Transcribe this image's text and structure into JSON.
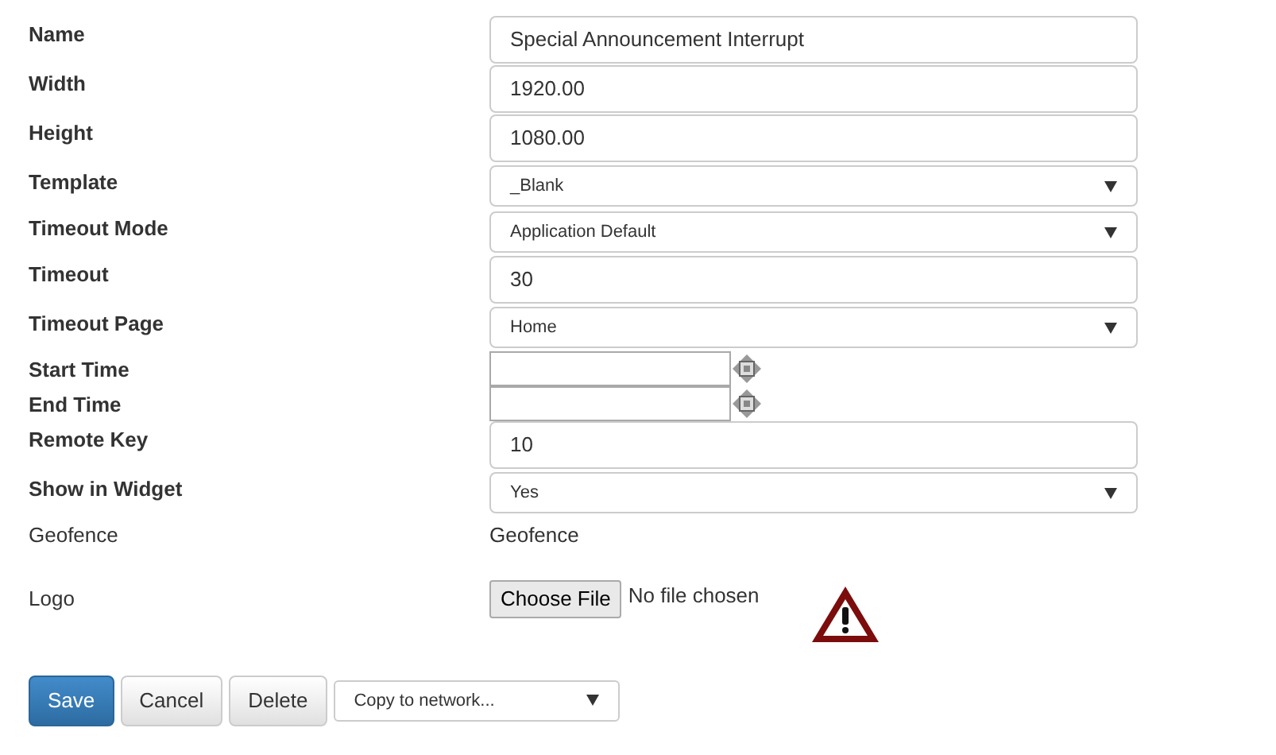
{
  "fields": [
    {
      "label": "Name",
      "kind": "text",
      "value": "Special Announcement Interrupt"
    },
    {
      "label": "Width",
      "kind": "text",
      "value": "1920.00"
    },
    {
      "label": "Height",
      "kind": "text",
      "value": "1080.00"
    },
    {
      "label": "Template",
      "kind": "select",
      "value": "_Blank"
    },
    {
      "label": "Timeout Mode",
      "kind": "select",
      "value": "Application Default"
    },
    {
      "label": "Timeout",
      "kind": "text",
      "value": "30"
    },
    {
      "label": "Timeout Page",
      "kind": "select",
      "value": "Home"
    },
    {
      "label": "Start Time",
      "kind": "datetime"
    },
    {
      "label": "End Time",
      "kind": "datetime"
    },
    {
      "label": "Remote Key",
      "kind": "text",
      "value": "10"
    },
    {
      "label": "Show in Widget",
      "kind": "select",
      "value": "Yes"
    },
    {
      "label": "Geofence",
      "kind": "static",
      "value": "Geofence"
    },
    {
      "label": "Logo",
      "kind": "file",
      "button": "Choose File",
      "value": "No file chosen"
    }
  ],
  "buttons": [
    {
      "label": "Save",
      "kind": "primary"
    },
    {
      "label": "Cancel",
      "kind": "default"
    },
    {
      "label": "Delete",
      "kind": "default"
    }
  ],
  "copy_select": {
    "value": "Copy to network..."
  }
}
